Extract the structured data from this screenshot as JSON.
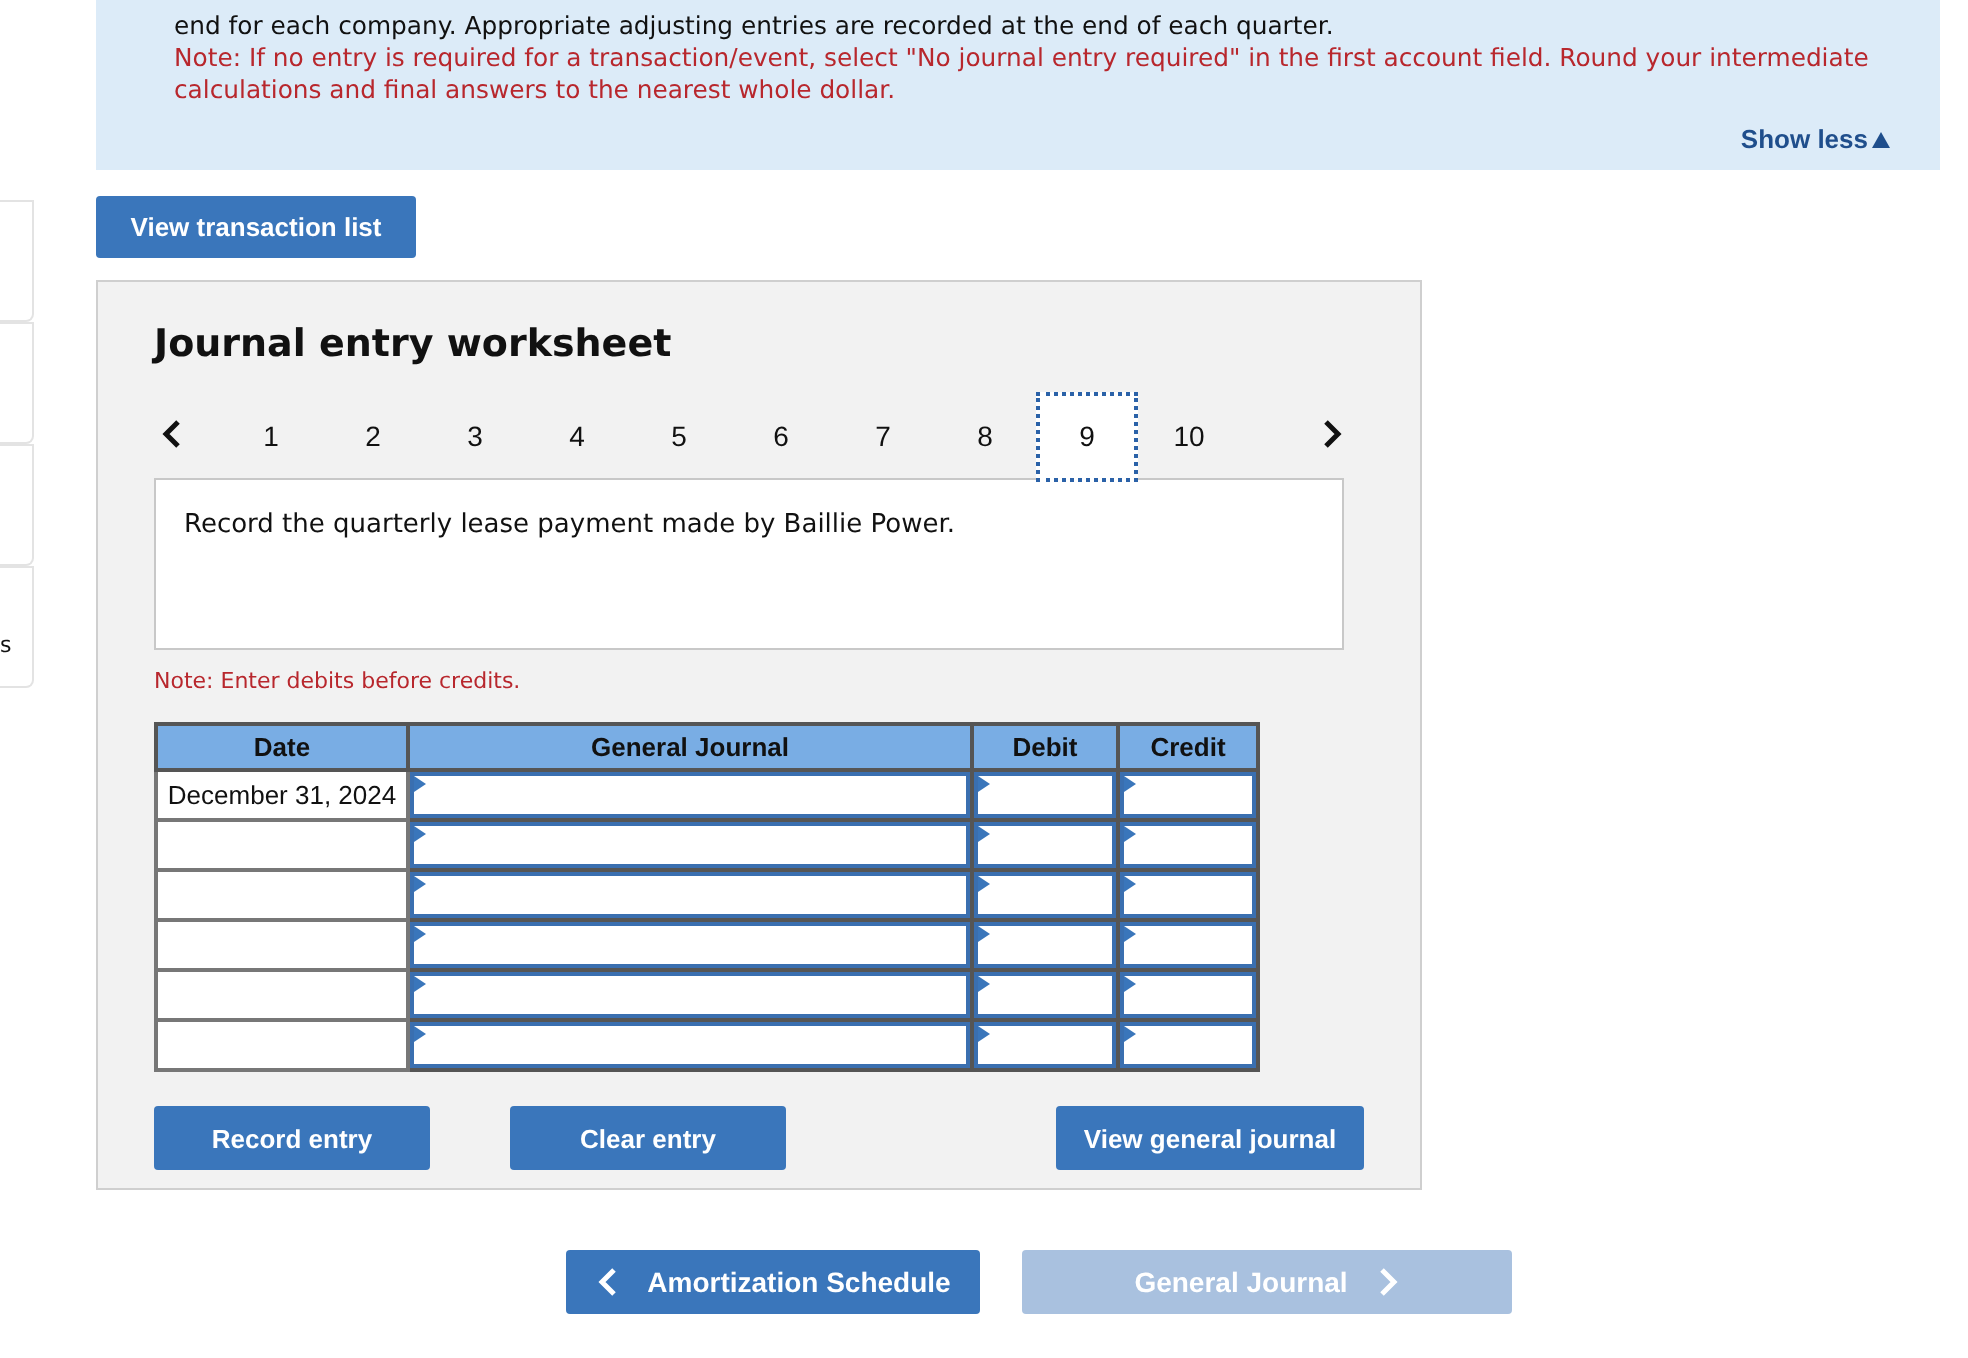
{
  "sidebar": {
    "items": [
      {
        "kind": "card"
      },
      {
        "kind": "card"
      },
      {
        "kind": "card"
      },
      {
        "kind": "card",
        "label": "s"
      }
    ]
  },
  "instructions": {
    "text": "end for each company. Appropriate adjusting entries are recorded at the end of each quarter.",
    "note": "Note: If no entry is required for a transaction/event, select \"No journal entry required\" in the first account field. Round your intermediate calculations and final answers to the nearest whole dollar.",
    "toggle": "Show less"
  },
  "view_transaction_button": "View transaction list",
  "worksheet": {
    "title": "Journal entry worksheet",
    "tabs": [
      {
        "label": "1",
        "selected": false
      },
      {
        "label": "2",
        "selected": false
      },
      {
        "label": "3",
        "selected": false
      },
      {
        "label": "4",
        "selected": false
      },
      {
        "label": "5",
        "selected": false
      },
      {
        "label": "6",
        "selected": false
      },
      {
        "label": "7",
        "selected": false
      },
      {
        "label": "8",
        "selected": false
      },
      {
        "label": "9",
        "selected": true
      },
      {
        "label": "10",
        "selected": false
      }
    ],
    "description": "Record the quarterly lease payment made by Baillie Power.",
    "note": "Note: Enter debits before credits.",
    "table": {
      "columns": [
        "Date",
        "General Journal",
        "Debit",
        "Credit"
      ],
      "rows": [
        {
          "date": "December 31, 2024"
        },
        {
          "date": ""
        },
        {
          "date": ""
        },
        {
          "date": ""
        },
        {
          "date": ""
        },
        {
          "date": ""
        }
      ]
    },
    "buttons": [
      "Record entry",
      "Clear entry",
      "View general journal"
    ]
  },
  "navigation": [
    {
      "label": "Amortization Schedule",
      "kind": "back",
      "disabled": false
    },
    {
      "label": "General Journal",
      "kind": "forward",
      "disabled": true
    }
  ]
}
